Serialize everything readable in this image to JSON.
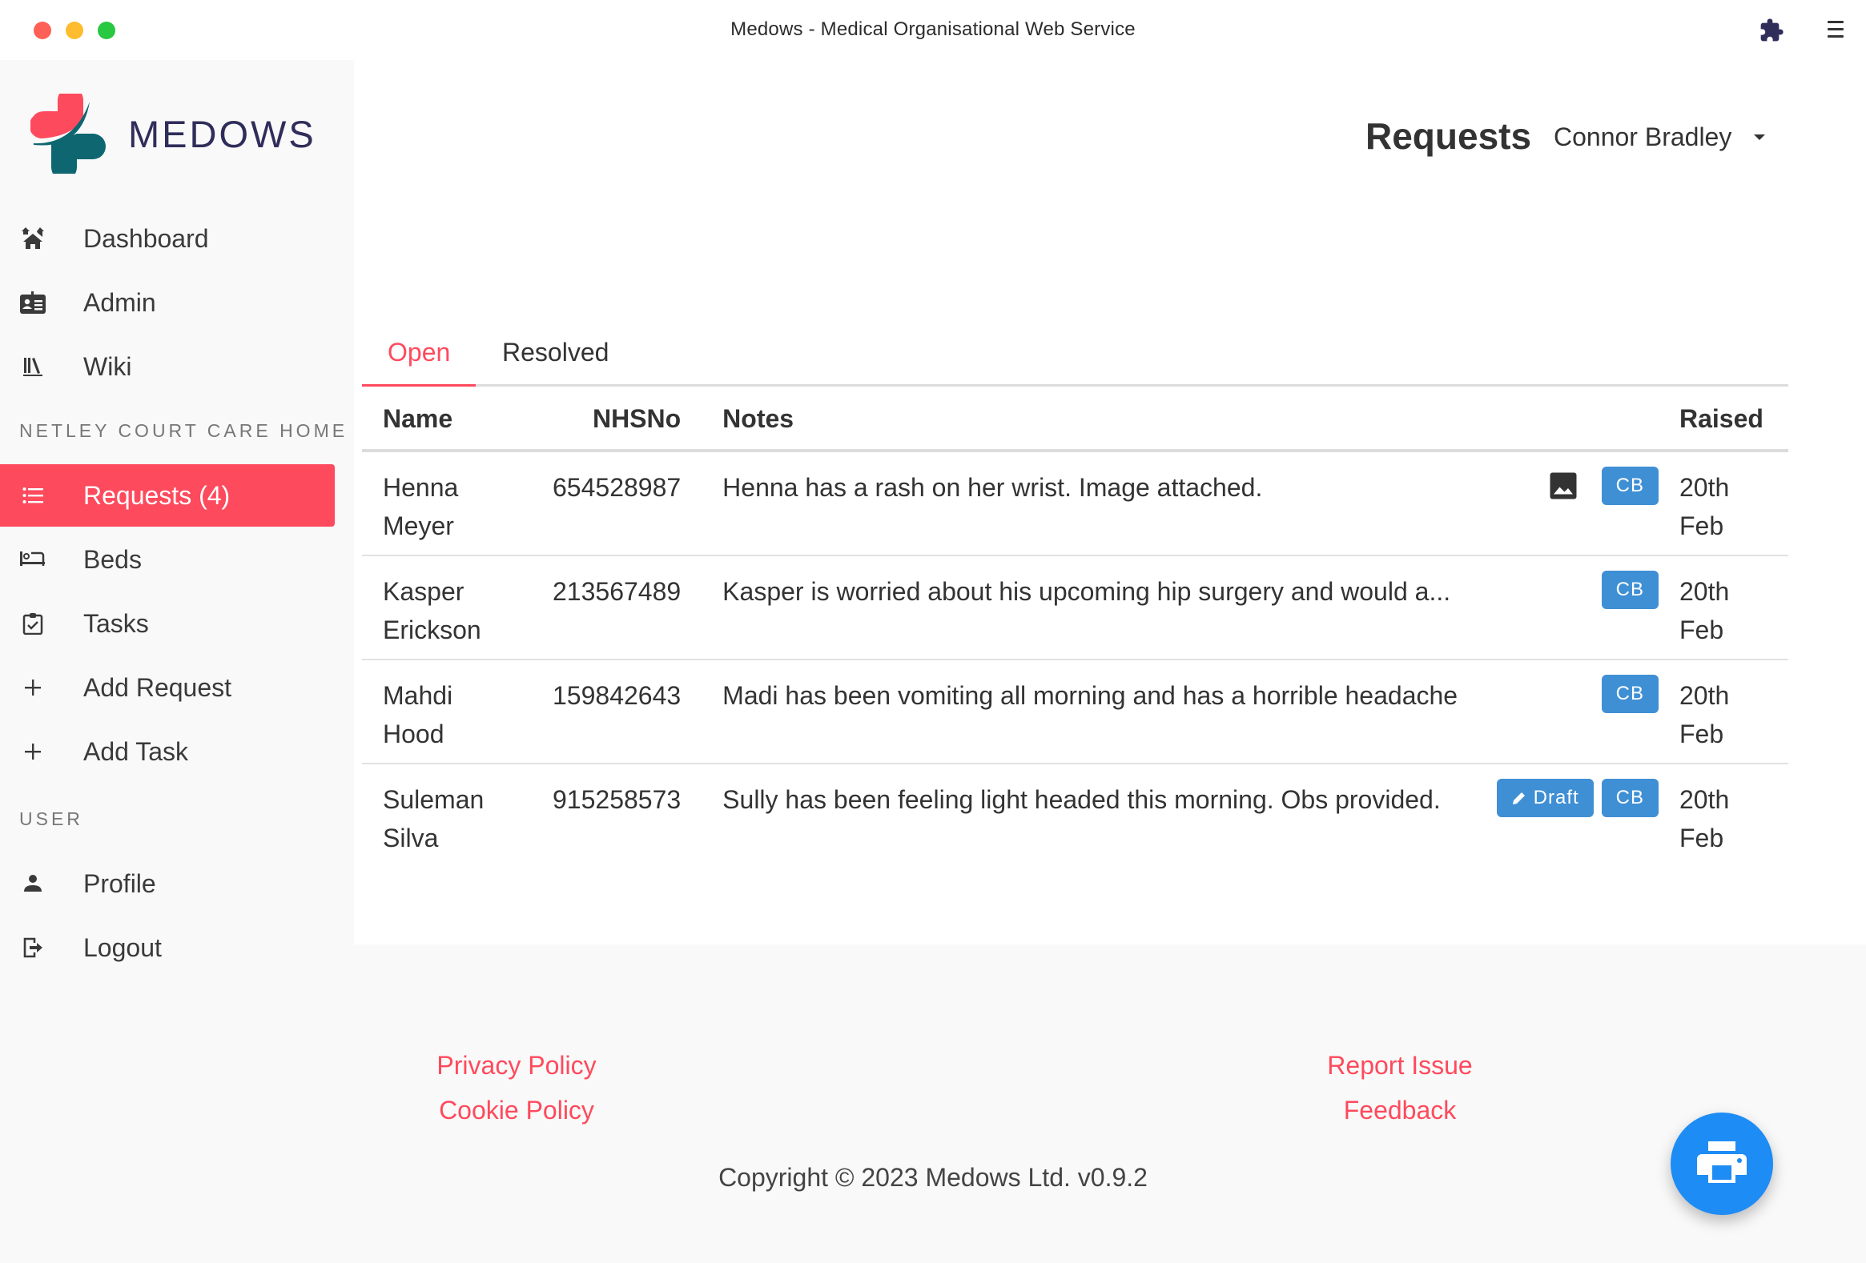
{
  "window": {
    "title": "Medows - Medical Organisational Web Service"
  },
  "brand": {
    "name": "MEDOWS",
    "colors": {
      "primary": "#fe4a5d",
      "teal": "#0e6670",
      "navy": "#2f2d5a",
      "chip_blue": "#3f8fd4",
      "fab_blue": "#1e8cf5"
    }
  },
  "sidebar": {
    "items_top": [
      {
        "label": "Dashboard",
        "icon": "home-group-icon"
      },
      {
        "label": "Admin",
        "icon": "id-card-icon"
      },
      {
        "label": "Wiki",
        "icon": "library-books-icon"
      }
    ],
    "section_home": "NETLEY COURT CARE HOME",
    "items_home": [
      {
        "label": "Requests (4)",
        "icon": "list-icon",
        "active": true
      },
      {
        "label": "Beds",
        "icon": "bed-icon"
      },
      {
        "label": "Tasks",
        "icon": "clipboard-check-icon"
      },
      {
        "label": "Add Request",
        "icon": "plus-icon"
      },
      {
        "label": "Add Task",
        "icon": "plus-icon"
      }
    ],
    "section_user": "USER",
    "items_user": [
      {
        "label": "Profile",
        "icon": "person-icon"
      },
      {
        "label": "Logout",
        "icon": "logout-icon"
      }
    ]
  },
  "header": {
    "title": "Requests",
    "user_name": "Connor Bradley"
  },
  "tabs": [
    {
      "label": "Open",
      "active": true
    },
    {
      "label": "Resolved",
      "active": false
    }
  ],
  "table": {
    "columns": [
      "Name",
      "NHSNo",
      "Notes",
      "Raised"
    ],
    "rows": [
      {
        "first": "Henna",
        "last": "Meyer",
        "nhs": "654528987",
        "notes": "Henna has a rash on her wrist. Image attached.",
        "has_image": true,
        "draft": false,
        "assignee": "CB",
        "raised_day": "20th",
        "raised_month": "Feb"
      },
      {
        "first": "Kasper",
        "last": "Erickson",
        "nhs": "213567489",
        "notes": "Kasper is worried about his upcoming hip surgery and would a...",
        "has_image": false,
        "draft": false,
        "assignee": "CB",
        "raised_day": "20th",
        "raised_month": "Feb"
      },
      {
        "first": "Mahdi",
        "last": "Hood",
        "nhs": "159842643",
        "notes": "Madi has been vomiting all morning and has a horrible headache",
        "has_image": false,
        "draft": false,
        "assignee": "CB",
        "raised_day": "20th",
        "raised_month": "Feb"
      },
      {
        "first": "Suleman",
        "last": "Silva",
        "nhs": "915258573",
        "notes": "Sully has been feeling light headed this morning. Obs provided.",
        "has_image": false,
        "draft": true,
        "assignee": "CB",
        "raised_day": "20th",
        "raised_month": "Feb"
      }
    ],
    "draft_label": "Draft"
  },
  "footer": {
    "privacy": "Privacy Policy",
    "cookie": "Cookie Policy",
    "report": "Report Issue",
    "feedback": "Feedback",
    "copyright": "Copyright © 2023 Medows Ltd. v0.9.2"
  },
  "fab": {
    "icon": "printer-icon"
  }
}
